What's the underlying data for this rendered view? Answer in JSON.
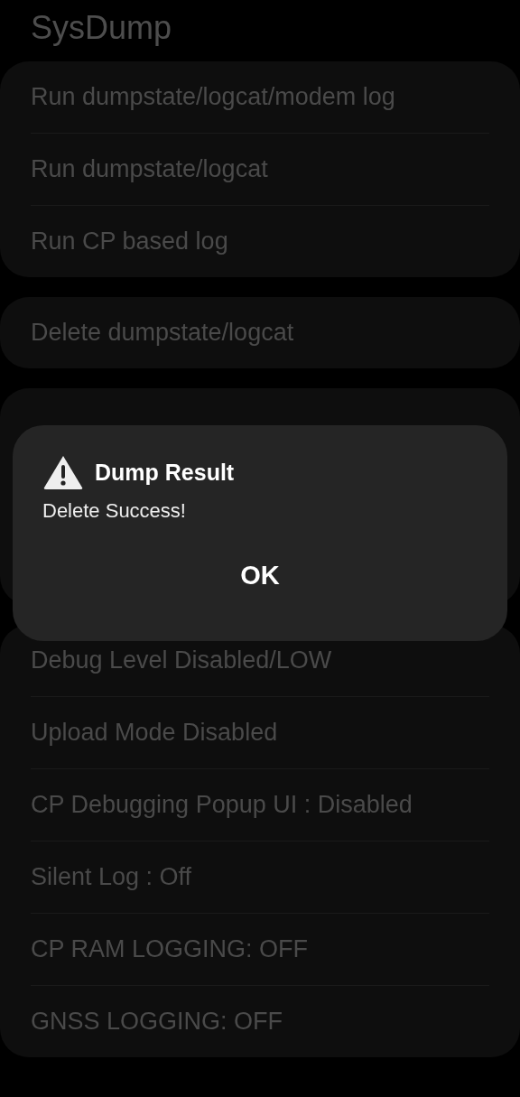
{
  "title": "SysDump",
  "groups_above": [
    {
      "items": [
        "Run dumpstate/logcat/modem log",
        "Run dumpstate/logcat",
        "Run CP based log"
      ]
    },
    {
      "items": [
        "Delete dumpstate/logcat"
      ]
    }
  ],
  "groups_below": [
    {
      "items": [
        "Debug Level Disabled/LOW",
        "Upload Mode Disabled",
        "CP Debugging Popup UI : Disabled",
        "Silent Log : Off",
        "CP RAM LOGGING: OFF",
        "GNSS LOGGING: OFF"
      ]
    }
  ],
  "dialog": {
    "title": "Dump Result",
    "message": "Delete Success!",
    "button": "OK"
  }
}
